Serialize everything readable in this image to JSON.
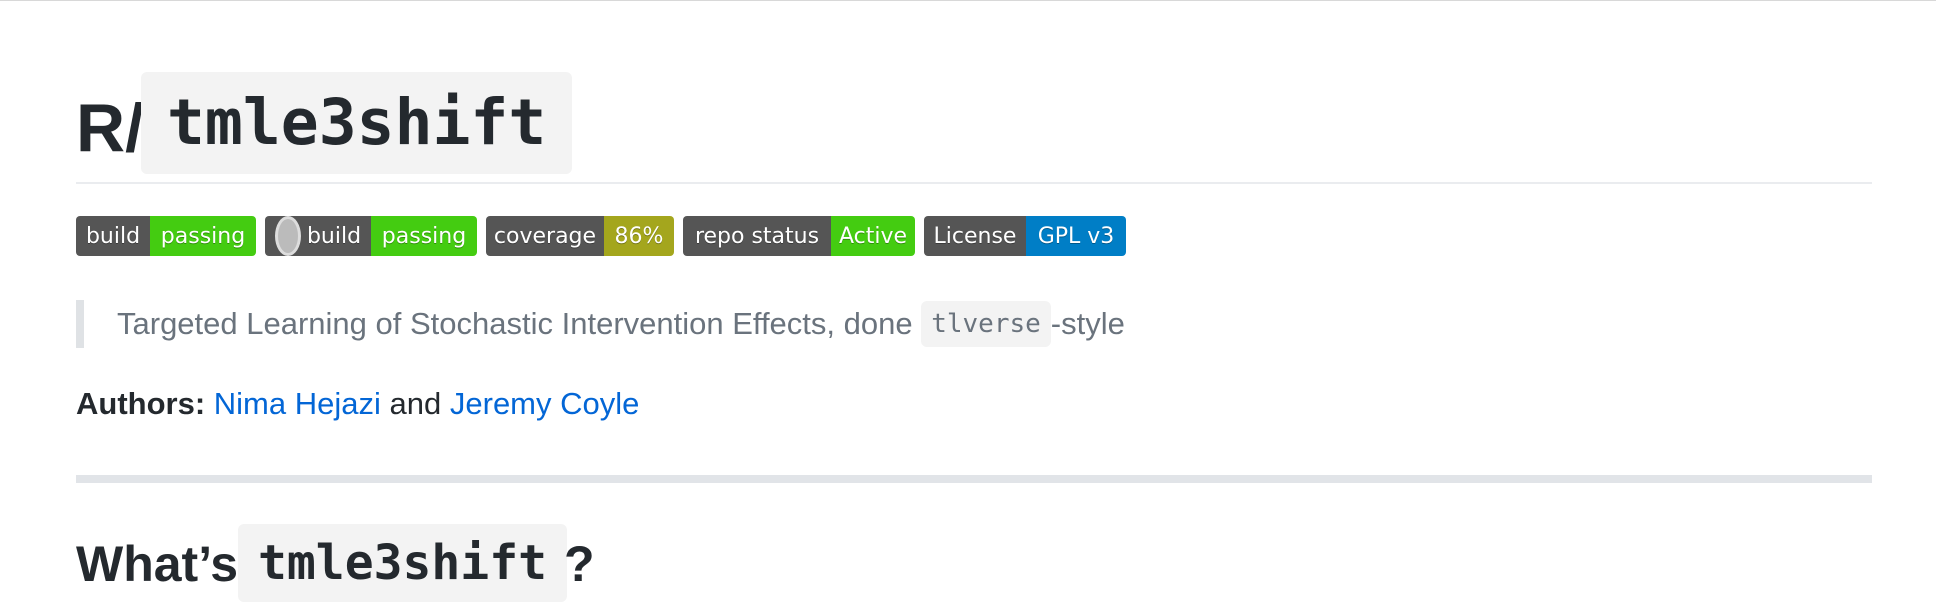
{
  "header": {
    "prefix": "R/",
    "package": "tmle3shift"
  },
  "badges": [
    {
      "label": "build",
      "value": "passing",
      "color": "#4c1"
    },
    {
      "label": "build",
      "value": "passing",
      "color": "#4c1",
      "icon": "appveyor-icon"
    },
    {
      "label": "coverage",
      "value": "86%",
      "color": "#a4a61d"
    },
    {
      "label": "repo status",
      "value": "Active",
      "color": "#4c1"
    },
    {
      "label": "License",
      "value": "GPL v3",
      "color": "#007ec6"
    }
  ],
  "description": {
    "text_before": "Targeted Learning of Stochastic Intervention Effects, done ",
    "code": "tlverse",
    "text_after": "-style"
  },
  "authors": {
    "label": "Authors:",
    "author1": "Nima Hejazi",
    "joiner": "and",
    "author2": "Jeremy Coyle"
  },
  "section": {
    "prefix": "What’s",
    "code": "tmle3shift",
    "suffix": "?"
  }
}
